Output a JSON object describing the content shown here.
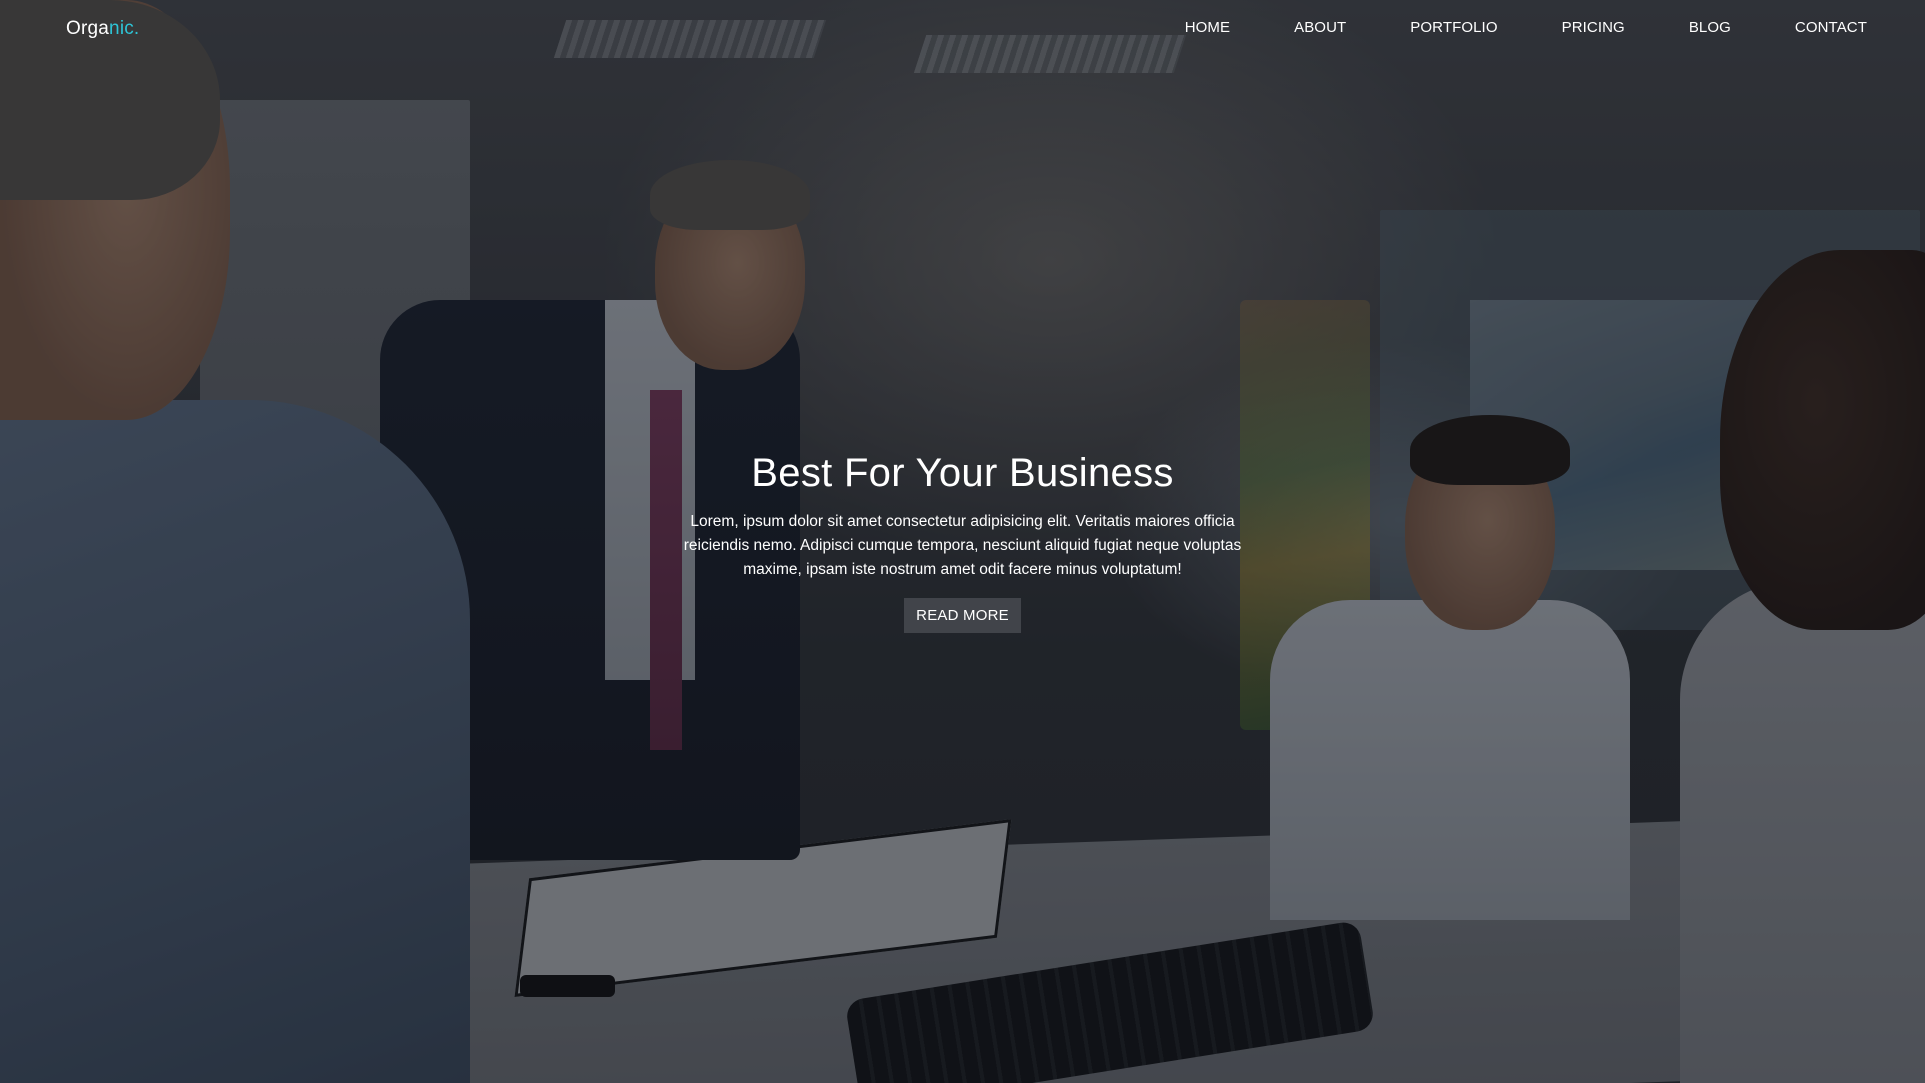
{
  "header": {
    "logo_part1": "Orga",
    "logo_part2": "nic.",
    "nav": [
      {
        "label": "HOME"
      },
      {
        "label": "ABOUT"
      },
      {
        "label": "PORTFOLIO"
      },
      {
        "label": "PRICING"
      },
      {
        "label": "BLOG"
      },
      {
        "label": "CONTACT"
      }
    ]
  },
  "hero": {
    "title": "Best For Your Business",
    "text": "Lorem, ipsum dolor sit amet consectetur adipisicing elit. Veritatis maiores officia reiciendis nemo. Adipisci cumque tempora, nesciunt aliquid fugiat neque voluptas maxime, ipsam iste nostrum amet odit facere minus voluptatum!",
    "button_label": "READ MORE"
  },
  "colors": {
    "accent": "#2ec4d6",
    "text": "#ffffff",
    "overlay": "rgba(15,18,24,0.45)"
  }
}
